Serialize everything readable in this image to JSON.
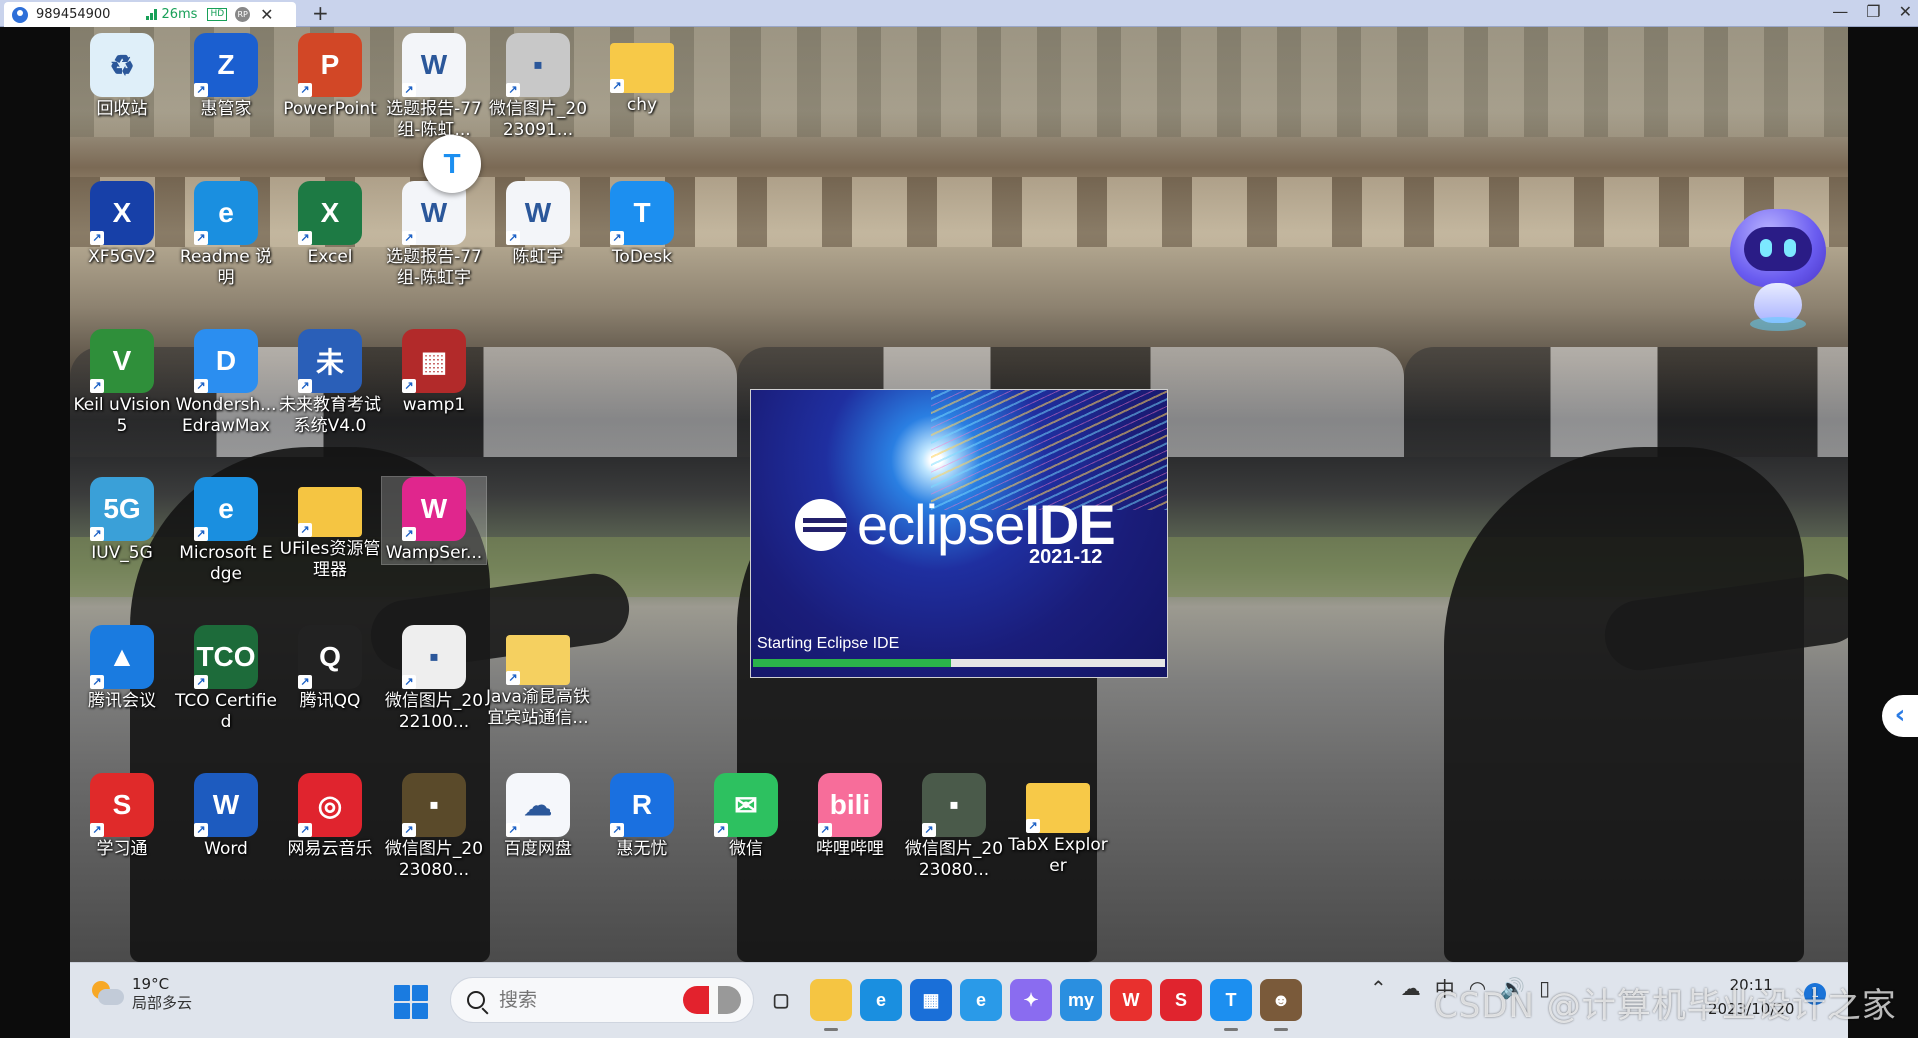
{
  "session": {
    "id": "989454900",
    "latency": "26ms",
    "quality_badge": "HD",
    "extra_badge": "RP",
    "new_tab": "+",
    "window_controls": [
      "—",
      "❐",
      "✕"
    ]
  },
  "desktop_icons": [
    {
      "name": "recycle-bin",
      "label": "回收站",
      "color": "#dfeff9",
      "glyph": "♻"
    },
    {
      "name": "huiguanjia",
      "label": "惠管家",
      "color": "#1b5fd0",
      "glyph": "Z"
    },
    {
      "name": "powerpoint",
      "label": "PowerPoint",
      "color": "#d24726",
      "glyph": "P"
    },
    {
      "name": "word-doc-1",
      "label": "选题报告-77组-陈虹...",
      "color": "#f3f5f9",
      "glyph": "W"
    },
    {
      "name": "wechat-img-1",
      "label": "微信图片_2023091...",
      "color": "#c8c8c8",
      "glyph": "▪"
    },
    {
      "name": "chy-folder",
      "label": "chy",
      "color": "#f7c948",
      "glyph": ""
    },
    {
      "name": "xf5gv2",
      "label": "XF5GV2",
      "color": "#1740a8",
      "glyph": "X"
    },
    {
      "name": "readme",
      "label": "Readme 说明",
      "color": "#1a8fe0",
      "glyph": "e"
    },
    {
      "name": "excel",
      "label": "Excel",
      "color": "#1d7a44",
      "glyph": "X"
    },
    {
      "name": "word-doc-2",
      "label": "选题报告-77组-陈虹宇",
      "color": "#f3f5f9",
      "glyph": "W"
    },
    {
      "name": "word-doc-3",
      "label": "陈虹宇",
      "color": "#f3f5f9",
      "glyph": "W"
    },
    {
      "name": "todesk",
      "label": "ToDesk",
      "color": "#1c8ff0",
      "glyph": "T"
    },
    {
      "name": "keil",
      "label": "Keil uVision5",
      "color": "#2f8f3a",
      "glyph": "V"
    },
    {
      "name": "edrawmax",
      "label": "Wondersh... EdrawMax",
      "color": "#2b8ef0",
      "glyph": "D"
    },
    {
      "name": "future-edu",
      "label": "未来教育考试系统V4.0",
      "color": "#2a5fb8",
      "glyph": "未"
    },
    {
      "name": "wamp1",
      "label": "wamp1",
      "color": "#b22a2a",
      "glyph": "▦"
    },
    {
      "name": "iuv-5g",
      "label": "IUV_5G",
      "color": "#3aa0d8",
      "glyph": "5G"
    },
    {
      "name": "edge",
      "label": "Microsoft Edge",
      "color": "#1a8fe0",
      "glyph": "e"
    },
    {
      "name": "ufiles",
      "label": "UFiles资源管理器",
      "color": "#f5c542",
      "glyph": ""
    },
    {
      "name": "wampserver",
      "label": "WampSer...",
      "color": "#e0268d",
      "glyph": "W"
    },
    {
      "name": "tencent-meeting",
      "label": "腾讯会议",
      "color": "#1a7be0",
      "glyph": "▲"
    },
    {
      "name": "tco-certified",
      "label": "TCO Certified",
      "color": "#1d6b3a",
      "glyph": "TCO"
    },
    {
      "name": "tencent-qq",
      "label": "腾讯QQ",
      "color": "#222222",
      "glyph": "Q"
    },
    {
      "name": "wechat-img-2",
      "label": "微信图片_2022100...",
      "color": "#eeeeee",
      "glyph": "▪"
    },
    {
      "name": "java-folder",
      "label": "Java渝昆高铁宜宾站通信...",
      "color": "#f5d060",
      "glyph": ""
    },
    {
      "name": "xuexitong",
      "label": "学习通",
      "color": "#e02a2a",
      "glyph": "S"
    },
    {
      "name": "word",
      "label": "Word",
      "color": "#1d5bbf",
      "glyph": "W"
    },
    {
      "name": "netease-music",
      "label": "网易云音乐",
      "color": "#e0242e",
      "glyph": "◎"
    },
    {
      "name": "wechat-img-3",
      "label": "微信图片_2023080...",
      "color": "#5a4a2a",
      "glyph": "▪"
    },
    {
      "name": "baidu-netdisk",
      "label": "百度网盘",
      "color": "#f5f7fb",
      "glyph": "☁"
    },
    {
      "name": "huiwuyou",
      "label": "惠无忧",
      "color": "#1a70e0",
      "glyph": "R"
    },
    {
      "name": "wechat",
      "label": "微信",
      "color": "#2dc160",
      "glyph": "✉"
    },
    {
      "name": "bilibili",
      "label": "哔哩哔哩",
      "color": "#f76d9a",
      "glyph": "bili"
    },
    {
      "name": "wechat-img-4",
      "label": "微信图片_2023080...",
      "color": "#4a5a4a",
      "glyph": "▪"
    },
    {
      "name": "tabx-explorer",
      "label": "TabX Explorer",
      "color": "#f7c948",
      "glyph": ""
    }
  ],
  "splash": {
    "brand_light": "eclipse",
    "brand_bold": "IDE",
    "version": "2021-12",
    "status": "Starting Eclipse IDE",
    "progress": 0.48
  },
  "taskbar": {
    "weather_temp": "19°C",
    "weather_desc": "局部多云",
    "search_placeholder": "搜索",
    "apps": [
      {
        "name": "task-view",
        "glyph": "▢",
        "color": "#333333"
      },
      {
        "name": "file-explorer",
        "glyph": "",
        "color": "#f5c542"
      },
      {
        "name": "edge",
        "glyph": "e",
        "color": "#1a8fe0"
      },
      {
        "name": "store",
        "glyph": "▦",
        "color": "#1a6fd8"
      },
      {
        "name": "ie-like",
        "glyph": "e",
        "color": "#2a9ae8"
      },
      {
        "name": "copilot",
        "glyph": "✦",
        "color": "#8a6cf0"
      },
      {
        "name": "myeclipse",
        "glyph": "my",
        "color": "#2a8fe0"
      },
      {
        "name": "wps",
        "glyph": "W",
        "color": "#e8302e"
      },
      {
        "name": "xuexitong",
        "glyph": "S",
        "color": "#e0242e"
      },
      {
        "name": "todesk",
        "glyph": "T",
        "color": "#1c8ff0"
      },
      {
        "name": "user-app",
        "glyph": "☻",
        "color": "#7a5a3a"
      }
    ],
    "tray": [
      "⌃",
      "☁",
      "中",
      "◠",
      "🔊",
      "▯"
    ],
    "time": "20:11",
    "date": "2023/10/20",
    "notification_count": "1"
  },
  "watermark": "CSDN @计算机毕业设计之家"
}
